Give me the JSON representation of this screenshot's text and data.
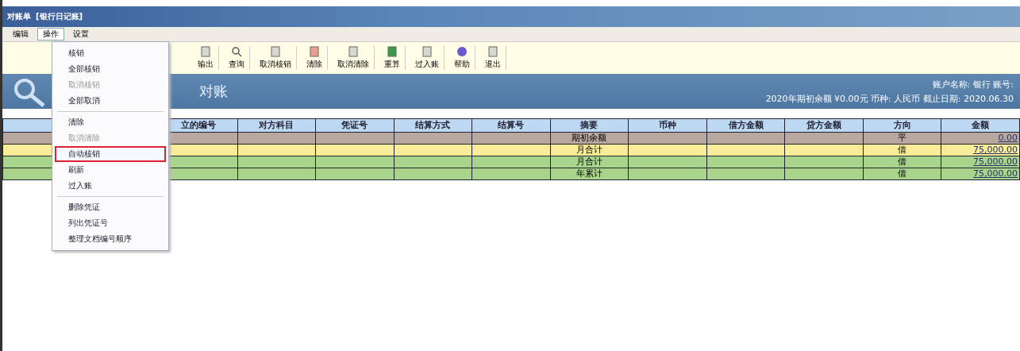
{
  "window": {
    "title": "对账单",
    "subtitle": "[银行日记账]"
  },
  "menubar": [
    {
      "label": "编辑",
      "selected": false
    },
    {
      "label": "操作",
      "selected": true
    },
    {
      "label": "设置",
      "selected": false
    }
  ],
  "toolbar": [
    {
      "label": "输出",
      "kind": "doc"
    },
    {
      "label": "查询",
      "kind": "find"
    },
    {
      "label": "取消核销",
      "kind": "doc"
    },
    {
      "label": "清除",
      "kind": "red"
    },
    {
      "label": "取消清除",
      "kind": "doc"
    },
    {
      "label": "重算",
      "kind": "green"
    },
    {
      "label": "过入账",
      "kind": "doc"
    },
    {
      "label": "帮助",
      "kind": "help"
    },
    {
      "label": "退出",
      "kind": "doc"
    }
  ],
  "banner": {
    "title": "对账",
    "info_1": "账户名称: 银行  账号:",
    "info_2": "2020年期初余额  ¥0.00元  币种: 人民币  截止日期: 2020.06.30"
  },
  "menu": [
    {
      "label": "核销",
      "disabled": false,
      "selected": false
    },
    {
      "label": "全部核销",
      "disabled": false,
      "selected": false
    },
    {
      "label": "取消核销",
      "disabled": true,
      "selected": false
    },
    {
      "label": "全部取消",
      "disabled": false,
      "selected": false
    },
    {
      "label": "清除",
      "disabled": false,
      "selected": false,
      "separator": true
    },
    {
      "label": "取消清除",
      "disabled": true,
      "selected": false
    },
    {
      "label": "自动核销",
      "disabled": false,
      "selected": true
    },
    {
      "label": "刷新",
      "disabled": false,
      "selected": false
    },
    {
      "label": "过入账",
      "disabled": false,
      "selected": false
    },
    {
      "label": "删除凭证",
      "disabled": false,
      "selected": false,
      "separator": true
    },
    {
      "label": "列出凭证号",
      "disabled": false,
      "selected": false
    },
    {
      "label": "整理文档编号顺序",
      "disabled": false,
      "selected": false
    }
  ],
  "table": {
    "columns": [
      "立的编号",
      "对方科目",
      "凭证号",
      "结算方式",
      "结算号",
      "摘要",
      "币种",
      "借方金额",
      "贷方金额",
      "方向",
      "金额"
    ],
    "rows": [
      {
        "kind": "opening",
        "summary": "期初余额",
        "direction": "平",
        "amount": "0.00"
      },
      {
        "kind": "month",
        "summary": "月合计",
        "direction": "借",
        "amount": "75,000.00"
      },
      {
        "kind": "total",
        "summary": "月合计",
        "direction": "借",
        "amount": "75,000.00"
      },
      {
        "kind": "total",
        "summary": "年累计",
        "direction": "借",
        "amount": "75,000.00"
      }
    ]
  }
}
